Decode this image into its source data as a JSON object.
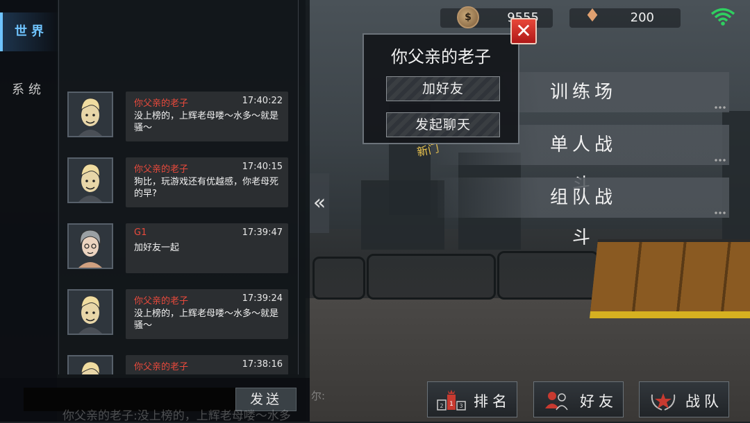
{
  "status": {
    "coins": "9555",
    "gems": "200"
  },
  "chat": {
    "tabs": [
      {
        "label": "世界",
        "active": true
      },
      {
        "label": "系统",
        "active": false
      }
    ],
    "messages": [
      {
        "name": "你父亲的老子",
        "time": "17:40:22",
        "text": "没上榜的，上辉老母喽～水多～就是骚～",
        "avatar": "blonde-character"
      },
      {
        "name": "你父亲的老子",
        "time": "17:40:15",
        "text": "狗比，玩游戏还有优越感，你老母死的早?",
        "avatar": "blonde-character"
      },
      {
        "name": "G1",
        "time": "17:39:47",
        "text": "加好友一起",
        "avatar": "grey-haired-character"
      },
      {
        "name": "你父亲的老子",
        "time": "17:39:24",
        "text": "没上榜的，上辉老母喽～水多～就是骚～",
        "avatar": "blonde-character"
      },
      {
        "name": "你父亲的老子",
        "time": "17:38:16",
        "text": "",
        "avatar": "blonde-character"
      }
    ],
    "input_value": "",
    "send_label": "发送",
    "ticker_text": "你父亲的老子:没上榜的，上辉老母喽～水多",
    "ticker_prefix": "尔:"
  },
  "popup": {
    "title": "你父亲的老子",
    "add_friend_label": "加好友",
    "start_chat_label": "发起聊天"
  },
  "modes": {
    "training": "训练场",
    "single": "单人战斗",
    "team": "组队战斗"
  },
  "bottom": {
    "rank_label": "排名",
    "friends_label": "好友",
    "team_label": "战队"
  },
  "colors": {
    "accent": "#6fc4ff",
    "name_red": "#ea4a3c",
    "close_red": "#d02a20",
    "wifi_green": "#2fd060"
  }
}
